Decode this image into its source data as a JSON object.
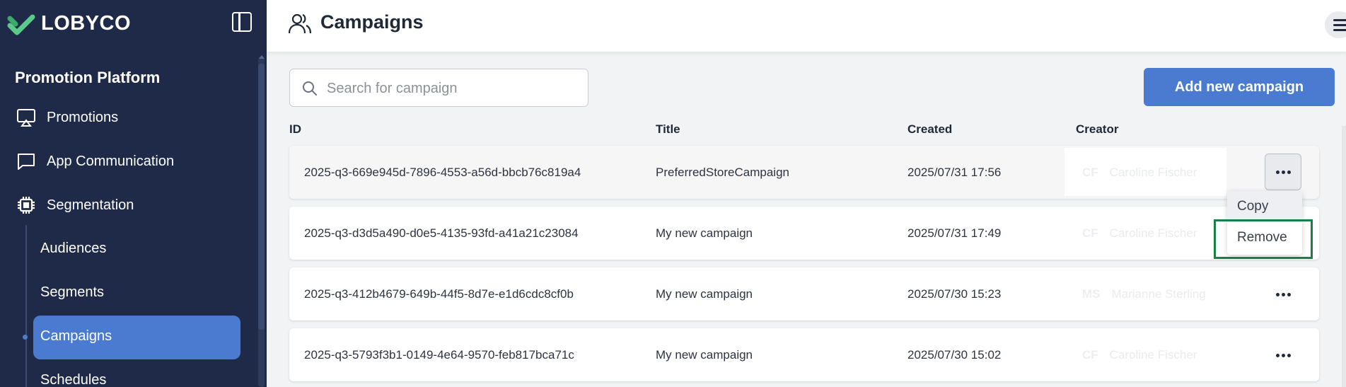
{
  "app": {
    "logo_text": "LOBYCO",
    "platform_title": "Promotion Platform"
  },
  "sidebar": {
    "items": [
      {
        "label": "Promotions",
        "icon": "presentation-icon"
      },
      {
        "label": "App Communication",
        "icon": "chat-icon"
      },
      {
        "label": "Segmentation",
        "icon": "chip-icon"
      }
    ],
    "subitems": [
      {
        "label": "Audiences"
      },
      {
        "label": "Segments"
      },
      {
        "label": "Campaigns",
        "active": true
      },
      {
        "label": "Schedules"
      }
    ]
  },
  "header": {
    "title": "Campaigns",
    "icon": "users-icon"
  },
  "toolbar": {
    "search_placeholder": "Search for campaign",
    "add_label": "Add new campaign"
  },
  "table": {
    "columns": [
      "ID",
      "Title",
      "Created",
      "Creator"
    ],
    "rows": [
      {
        "id": "2025-q3-669e945d-7896-4553-a56d-bbcb76c819a4",
        "title": "PreferredStoreCampaign",
        "created": "2025/07/31 17:56",
        "creator_initials": "CF",
        "creator_name": "Caroline Fischer"
      },
      {
        "id": "2025-q3-d3d5a490-d0e5-4135-93fd-a41a21c23084",
        "title": "My new campaign",
        "created": "2025/07/31 17:49",
        "creator_initials": "CF",
        "creator_name": "Caroline Fischer"
      },
      {
        "id": "2025-q3-412b4679-649b-44f5-8d7e-e1d6cdc8cf0b",
        "title": "My new campaign",
        "created": "2025/07/30 15:23",
        "creator_initials": "MS",
        "creator_name": "Marianne Sterling"
      },
      {
        "id": "2025-q3-5793f3b1-0149-4e64-9570-feb817bca71c",
        "title": "My new campaign",
        "created": "2025/07/30 15:02",
        "creator_initials": "CF",
        "creator_name": "Caroline Fischer"
      }
    ]
  },
  "dropdown": {
    "copy_label": "Copy",
    "remove_label": "Remove"
  },
  "colors": {
    "sidebar_bg": "#1e2a47",
    "accent": "#4a7bd0",
    "highlight": "#1a7f45"
  }
}
